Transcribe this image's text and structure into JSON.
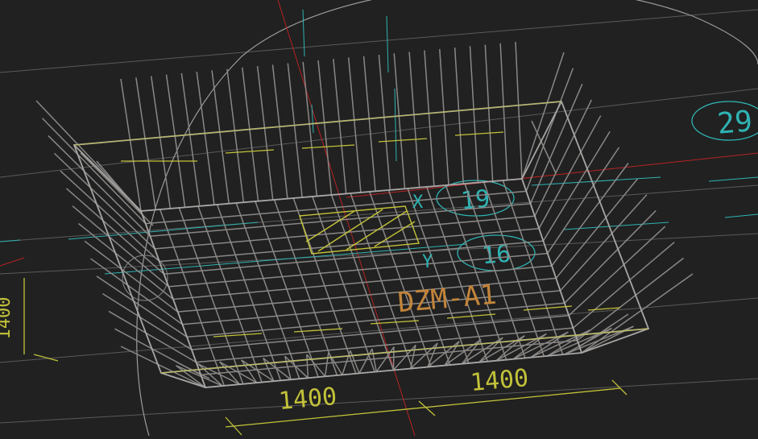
{
  "colors": {
    "background": "#212121",
    "rebar": "#8a8886",
    "outline": "#a8a6a4",
    "dimension": "#c2c23a",
    "axis": "#2fb3b3",
    "axis_red": "#b82222",
    "circle": "#9c9c9c",
    "grid": "#5a5a5a"
  },
  "labels": {
    "element_name": "DZM-A1",
    "bubble_a": "19",
    "bubble_b": "16",
    "bubble_c": "29",
    "axis_x": "X",
    "axis_y": "Y",
    "dim_left": "1400",
    "dim_right": "1400",
    "dim_vertical": "1400"
  }
}
